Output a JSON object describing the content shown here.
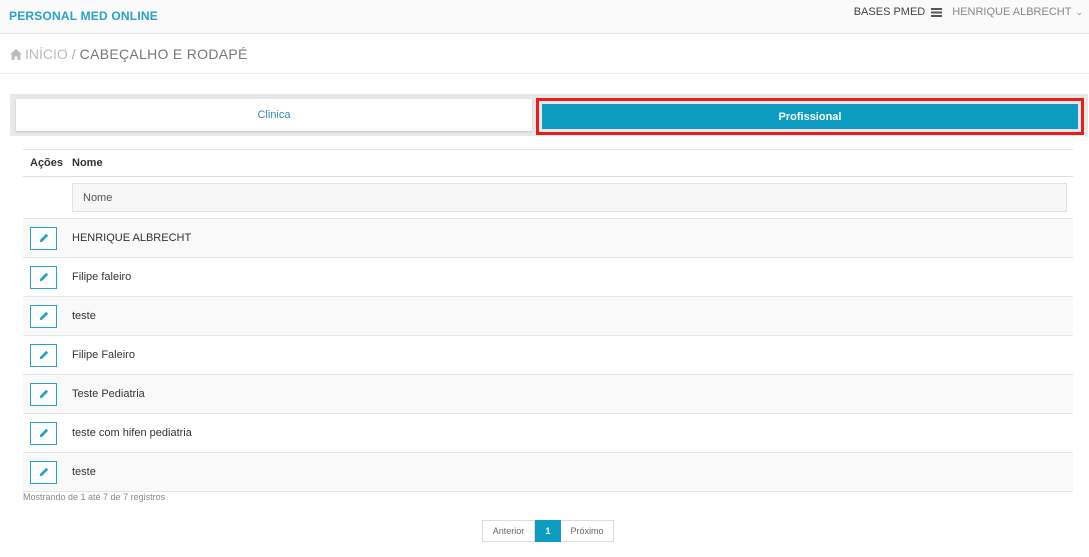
{
  "header": {
    "brand": "PERSONAL MED ONLINE",
    "bases_label": "BASES PMED",
    "bases_icon": "database-icon",
    "user_name": "HENRIQUE ALBRECHT",
    "user_menu_icon": "chevron-down-icon"
  },
  "breadcrumb": {
    "home_icon": "home-icon",
    "home": "INÍCIO",
    "separator": "/",
    "current": "CABEÇALHO E RODAPÉ"
  },
  "tabs": {
    "clinica": "Clinica",
    "profissional": "Profissional",
    "active": "profissional",
    "highlight_color": "#e41d1d",
    "active_color": "#0e9cc3"
  },
  "table": {
    "headers": {
      "acoes": "Ações",
      "nome": "Nome"
    },
    "filter_placeholder": "Nome",
    "edit_icon": "pencil-icon",
    "rows": [
      {
        "nome": "HENRIQUE ALBRECHT"
      },
      {
        "nome": "Filipe faleiro"
      },
      {
        "nome": "teste"
      },
      {
        "nome": "Filipe Faleiro"
      },
      {
        "nome": "Teste Pediatria"
      },
      {
        "nome": "teste com hifen pediatria"
      },
      {
        "nome": "teste"
      }
    ]
  },
  "footer": {
    "info": "Mostrando de 1 até 7 de 7 registros",
    "prev": "Anterior",
    "page": "1",
    "next": "Próximo"
  }
}
